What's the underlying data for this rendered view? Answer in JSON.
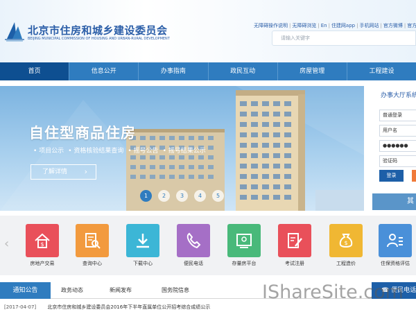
{
  "header": {
    "title": "北京市住房和城乡建设委员会",
    "subtitle": "BEIJING MUNICIPAL COMMISSION OF HOUSING AND URBAN-RURAL DEVELOPMENT",
    "top_links": [
      "无障碍操作说明",
      "无障碍浏览",
      "En",
      "住建网app",
      "手机网站",
      "官方微博",
      "官方微信"
    ],
    "search_placeholder": "请输入关键字"
  },
  "nav": {
    "items": [
      "首页",
      "信息公开",
      "办事指南",
      "政民互动",
      "房屋管理",
      "工程建设"
    ],
    "active_index": 0
  },
  "banner": {
    "title": "自住型商品住房",
    "links": [
      "项目公示",
      "资格核验结果查询",
      "摇号公告",
      "摇号结果公示"
    ],
    "detail_button": "了解详情",
    "pages": [
      "1",
      "2",
      "3",
      "4",
      "5"
    ],
    "active_page": 0
  },
  "login": {
    "title": "办事大厅系统",
    "login_type": "普通登录",
    "username": "用户名",
    "password": "●●●●●●",
    "captcha": "验证码",
    "login_button": "登录",
    "footer": "其"
  },
  "services": {
    "items": [
      {
        "label": "房地产交易",
        "icon": "house-money-icon",
        "color": "#e9505a"
      },
      {
        "label": "查询中心",
        "icon": "document-search-icon",
        "color": "#f29a3e"
      },
      {
        "label": "下载中心",
        "icon": "download-icon",
        "color": "#3cb6d6"
      },
      {
        "label": "便民电话",
        "icon": "phone-icon",
        "color": "#a56fc6"
      },
      {
        "label": "存量房平台",
        "icon": "certificate-icon",
        "color": "#49b97a"
      },
      {
        "label": "考试注册",
        "icon": "exam-edit-icon",
        "color": "#e9505a"
      },
      {
        "label": "工程造价",
        "icon": "money-bag-icon",
        "color": "#f0b733"
      },
      {
        "label": "住保资格评估",
        "icon": "person-list-icon",
        "color": "#4a90d9"
      }
    ]
  },
  "notices": {
    "tabs": [
      "通知公告",
      "政务动态",
      "新闻发布",
      "国务院信息"
    ],
    "hotline": "便民电话",
    "news": [
      {
        "date": "[2017-04-07]",
        "title": "北京市住房和城乡建设委员会2016年下半年直属单位公开招考综合成绩公示"
      }
    ]
  },
  "watermark": "IShareSite.com"
}
